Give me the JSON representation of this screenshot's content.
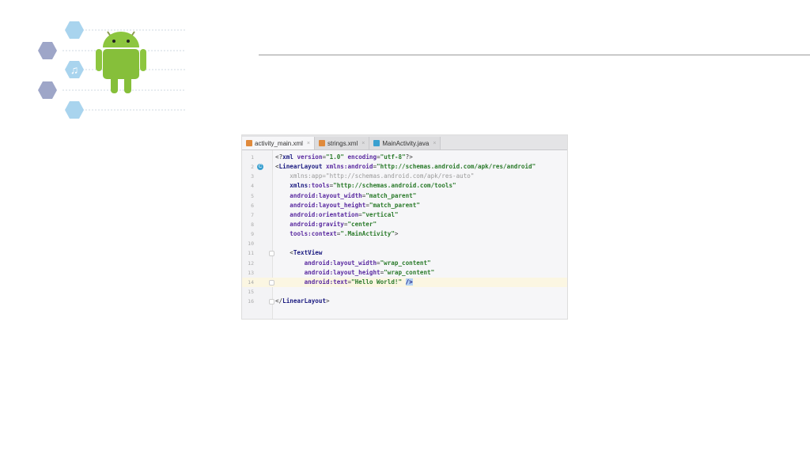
{
  "editor": {
    "tabs": [
      {
        "label": "activity_main.xml",
        "close": "×",
        "icon": "xml-file-icon",
        "color": "#e08a3c"
      },
      {
        "label": "strings.xml",
        "close": "×",
        "icon": "xml-file-icon",
        "color": "#e08a3c"
      },
      {
        "label": "MainActivity.java",
        "close": "×",
        "icon": "class-icon",
        "color": "#3aa0d0"
      }
    ],
    "active_tab": 0,
    "class_badge": "C",
    "lines": [
      [
        [
          "punc",
          "<?"
        ],
        [
          "tag",
          "xml "
        ],
        [
          "attr",
          "version"
        ],
        [
          "punc",
          "="
        ],
        [
          "val",
          "\"1.0\" "
        ],
        [
          "attr",
          "encoding"
        ],
        [
          "punc",
          "="
        ],
        [
          "val",
          "\"utf-8\""
        ],
        [
          "punc",
          "?>"
        ]
      ],
      [
        [
          "punc",
          "<"
        ],
        [
          "tag",
          "LinearLayout "
        ],
        [
          "attr",
          "xmlns:android"
        ],
        [
          "punc",
          "="
        ],
        [
          "val",
          "\"http://schemas.android.com/apk/res/android\""
        ]
      ],
      [
        [
          "dim",
          "    xmlns:app=\"http://schemas.android.com/apk/res-auto\""
        ]
      ],
      [
        [
          "punc",
          "    "
        ],
        [
          "tag",
          "xmlns"
        ],
        [
          "attr",
          ":tools"
        ],
        [
          "punc",
          "="
        ],
        [
          "val",
          "\"http://schemas.android.com/tools\""
        ]
      ],
      [
        [
          "punc",
          "    "
        ],
        [
          "attr",
          "android:layout_width"
        ],
        [
          "punc",
          "="
        ],
        [
          "val",
          "\"match_parent\""
        ]
      ],
      [
        [
          "punc",
          "    "
        ],
        [
          "attr",
          "android:layout_height"
        ],
        [
          "punc",
          "="
        ],
        [
          "val",
          "\"match_parent\""
        ]
      ],
      [
        [
          "punc",
          "    "
        ],
        [
          "attr",
          "android:orientation"
        ],
        [
          "punc",
          "="
        ],
        [
          "val",
          "\"vertical\""
        ]
      ],
      [
        [
          "punc",
          "    "
        ],
        [
          "attr",
          "android:gravity"
        ],
        [
          "punc",
          "="
        ],
        [
          "val",
          "\"center\""
        ]
      ],
      [
        [
          "punc",
          "    "
        ],
        [
          "attr",
          "tools:context"
        ],
        [
          "punc",
          "="
        ],
        [
          "val",
          "\".MainActivity\""
        ],
        [
          "punc",
          ">"
        ]
      ],
      [],
      [
        [
          "punc",
          "    <"
        ],
        [
          "tag",
          "TextView"
        ]
      ],
      [
        [
          "punc",
          "        "
        ],
        [
          "attr",
          "android:layout_width"
        ],
        [
          "punc",
          "="
        ],
        [
          "val",
          "\"wrap_content\""
        ]
      ],
      [
        [
          "punc",
          "        "
        ],
        [
          "attr",
          "android:layout_height"
        ],
        [
          "punc",
          "="
        ],
        [
          "val",
          "\"wrap_content\""
        ]
      ],
      [
        [
          "punc",
          "        "
        ],
        [
          "attr",
          "android:text"
        ],
        [
          "punc",
          "="
        ],
        [
          "val",
          "\"Hello World!\" "
        ],
        [
          "caret",
          "/>"
        ]
      ],
      [],
      [
        [
          "punc",
          "</"
        ],
        [
          "tag",
          "LinearLayout"
        ],
        [
          "punc",
          ">"
        ]
      ]
    ]
  }
}
